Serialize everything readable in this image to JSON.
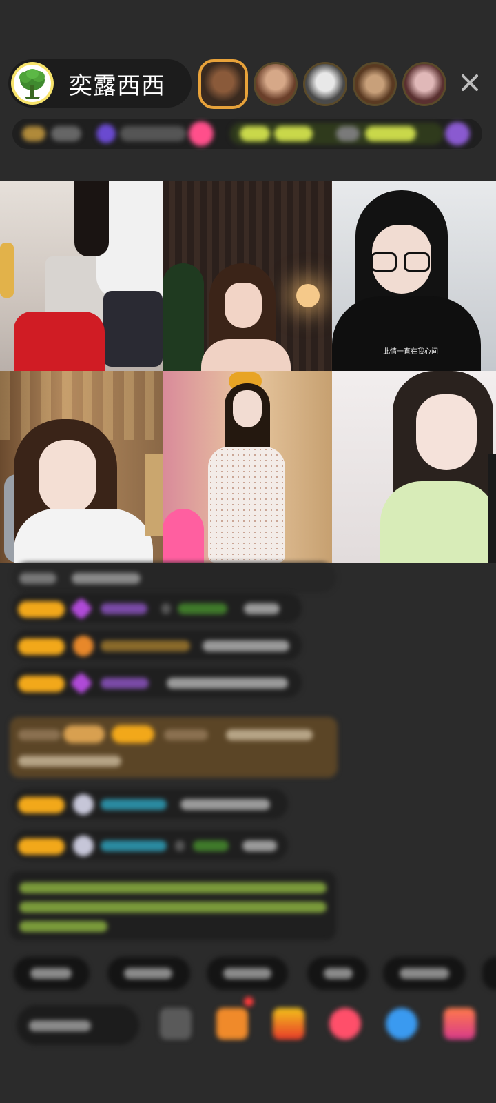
{
  "host": {
    "name": "奕露西西",
    "avatar_icon": "tree-logo-icon"
  },
  "viewers": [
    {
      "icon": "viewer-avatar-icon"
    },
    {
      "icon": "viewer-avatar-icon"
    },
    {
      "icon": "viewer-avatar-icon"
    },
    {
      "icon": "viewer-avatar-icon"
    },
    {
      "icon": "viewer-avatar-icon"
    }
  ],
  "close_icon": "close-icon",
  "video_grid": {
    "cells": [
      {
        "id": 1,
        "subtitle": ""
      },
      {
        "id": 2,
        "subtitle": ""
      },
      {
        "id": 3,
        "subtitle": "此情一直在我心间"
      },
      {
        "id": 4,
        "subtitle": ""
      },
      {
        "id": 5,
        "subtitle": ""
      },
      {
        "id": 6,
        "subtitle": ""
      }
    ]
  },
  "colors": {
    "background": "#2b2b2b",
    "badge": "#f2a81a",
    "system_message": "#5b4526",
    "accent_pink": "#ff4f8b"
  },
  "toolbar_icons": [
    "emoji-icon",
    "gift-box-icon",
    "prize-icon",
    "heart-message-icon",
    "chat-bubble-icon",
    "more-games-icon"
  ]
}
